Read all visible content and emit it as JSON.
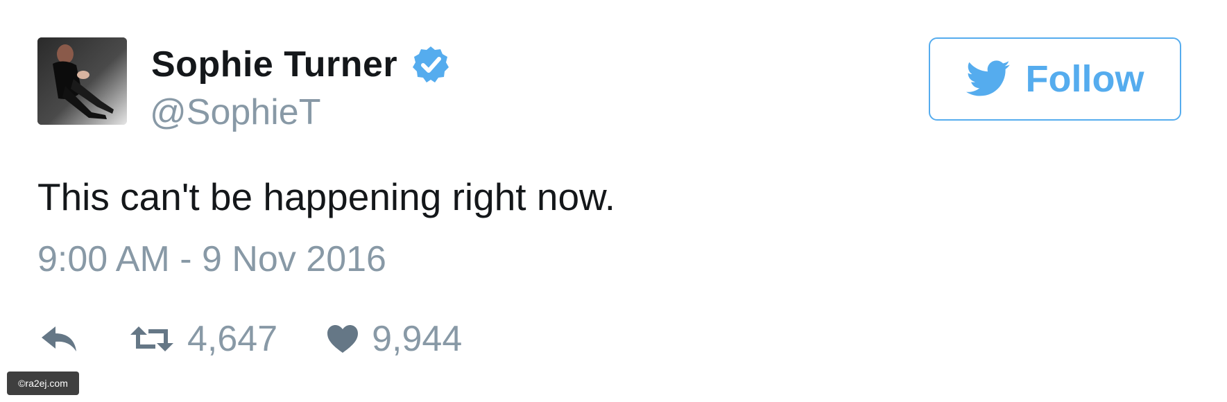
{
  "tweet": {
    "display_name": "Sophie Turner",
    "handle": "@SophieT",
    "verified": true,
    "text": "This can't be happening right now.",
    "timestamp": "9:00 AM - 9 Nov 2016",
    "retweets": "4,647",
    "likes": "9,944"
  },
  "follow_button": {
    "label": "Follow",
    "icon": "twitter-bird-icon"
  },
  "icons": {
    "reply": "reply-icon",
    "retweet": "retweet-icon",
    "like": "heart-icon",
    "verified": "verified-badge-icon"
  },
  "colors": {
    "brand": "#55acee",
    "text": "#14171a",
    "secondary": "#8899a6",
    "action_icon": "#657786"
  },
  "watermark": {
    "text": "©ra2ej.com"
  }
}
